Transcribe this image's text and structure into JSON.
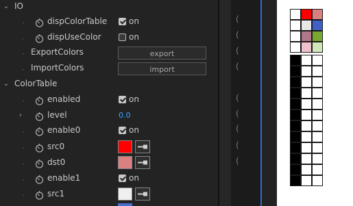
{
  "sections": {
    "io": {
      "label": "IO"
    },
    "colortable": {
      "label": "ColorTable"
    }
  },
  "props": {
    "dispColorTable": {
      "label": "dispColorTable",
      "checked": true,
      "value": "on"
    },
    "dispUseColor": {
      "label": "dispUseColor",
      "checked": false,
      "value": "on"
    },
    "exportColors": {
      "label": "ExportColors",
      "button": "export"
    },
    "importColors": {
      "label": "ImportColors",
      "button": "import"
    },
    "enabled": {
      "label": "enabled",
      "checked": true,
      "value": "on"
    },
    "level": {
      "label": "level",
      "value": "0.0"
    },
    "enable0": {
      "label": "enable0",
      "checked": true,
      "value": "on"
    },
    "src0": {
      "label": "src0",
      "color": "#ff0000"
    },
    "dst0": {
      "label": "dst0",
      "color": "#d98080"
    },
    "enable1": {
      "label": "enable1",
      "checked": true,
      "value": "on"
    },
    "src1": {
      "label": "src1",
      "color": "#efefef"
    }
  },
  "timeline": {
    "paren": "("
  },
  "palette_top": {
    "rows": [
      [
        "#ffffff",
        "#ff0000",
        "#d98080"
      ],
      [
        "#ffffff",
        "#e8e8e8",
        "#4060c8"
      ],
      [
        "#ffffff",
        "#b07888",
        "#78a830"
      ],
      [
        "#ffffff",
        "#f0c0cc",
        "#d0e8b8"
      ]
    ]
  },
  "palette_bottom": {
    "rows": [
      [
        "#000000",
        "#ffffff",
        "#ffffff"
      ],
      [
        "#000000",
        "#ffffff",
        "#ffffff"
      ],
      [
        "#000000",
        "#ffffff",
        "#ffffff"
      ],
      [
        "#000000",
        "#ffffff",
        "#ffffff"
      ],
      [
        "#000000",
        "#ffffff",
        "#ffffff"
      ],
      [
        "#000000",
        "#ffffff",
        "#ffffff"
      ],
      [
        "#000000",
        "#ffffff",
        "#ffffff"
      ],
      [
        "#000000",
        "#ffffff",
        "#ffffff"
      ],
      [
        "#000000",
        "#ffffff",
        "#ffffff"
      ],
      [
        "#000000",
        "#ffffff",
        "#ffffff"
      ],
      [
        "#000000",
        "#ffffff",
        "#ffffff"
      ],
      [
        "#000000",
        "#ffffff",
        "#ffffff"
      ]
    ]
  }
}
